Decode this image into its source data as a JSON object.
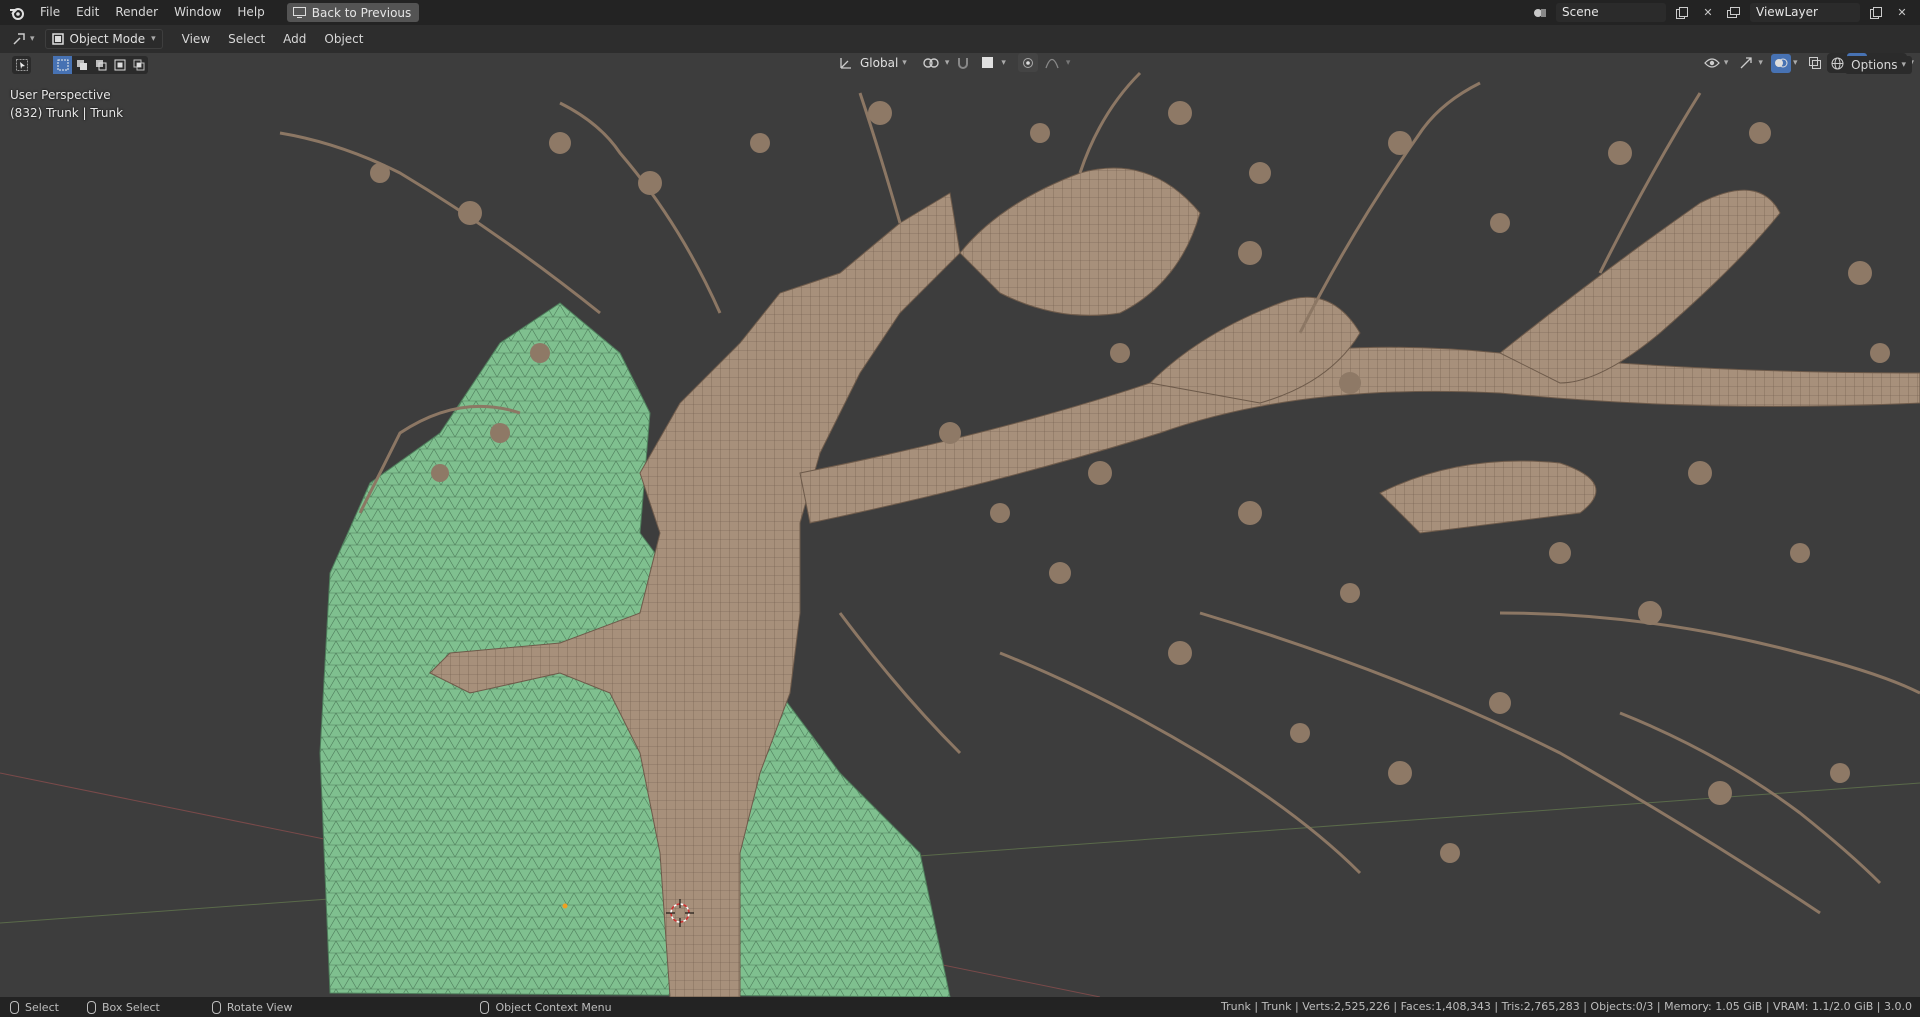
{
  "topbar": {
    "menus": [
      "File",
      "Edit",
      "Render",
      "Window",
      "Help"
    ],
    "back_button": "Back to Previous",
    "scene_name": "Scene",
    "view_layer": "ViewLayer"
  },
  "header": {
    "mode": "Object Mode",
    "menus": [
      "View",
      "Select",
      "Add",
      "Object"
    ],
    "transform_orientation": "Global",
    "options": "Options"
  },
  "viewport": {
    "perspective_label": "User Perspective",
    "object_label": "(832) Trunk | Trunk"
  },
  "statusbar": {
    "select": "Select",
    "box_select": "Box Select",
    "rotate_view": "Rotate View",
    "context_menu": "Object Context Menu",
    "stats": "Trunk | Trunk | Verts:2,525,226 | Faces:1,408,343 | Tris:2,765,283 | Objects:0/3 | Memory: 1.05 GiB | VRAM: 1.1/2.0 GiB | 3.0.0"
  },
  "colors": {
    "accent": "#4772b3",
    "rock": "#7fc08f",
    "tree": "#a7907b"
  }
}
